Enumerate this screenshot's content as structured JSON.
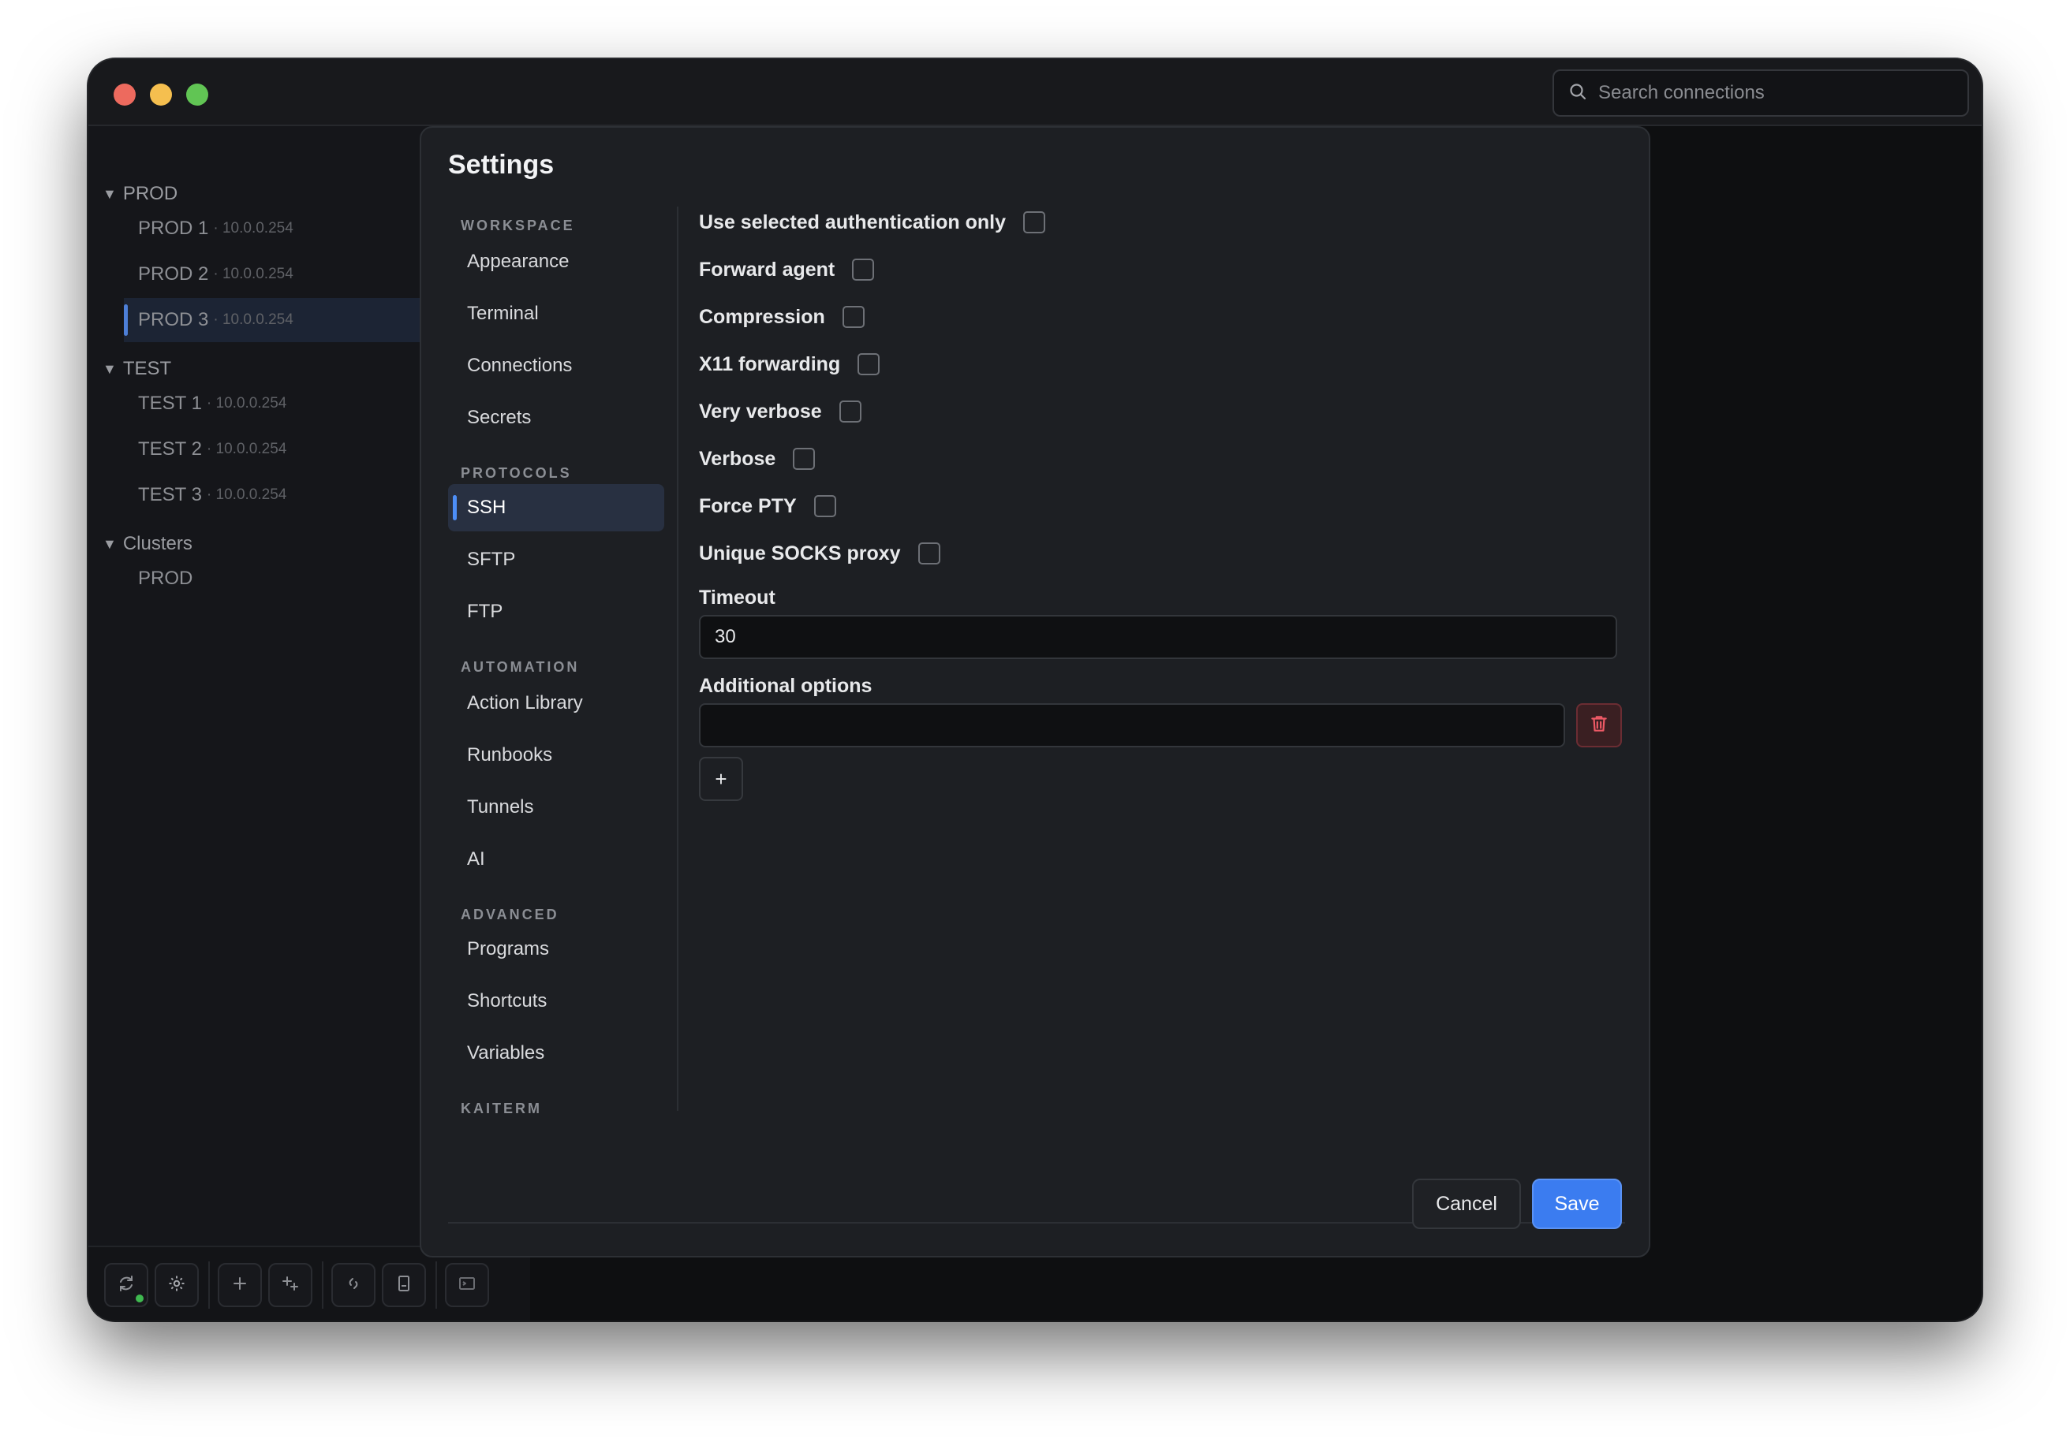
{
  "window": {
    "search_placeholder": "Search connections"
  },
  "sidebar": {
    "groups": [
      {
        "label": "PROD",
        "items": [
          {
            "name": "PROD 1",
            "ip": "· 10.0.0.254"
          },
          {
            "name": "PROD 2",
            "ip": "· 10.0.0.254"
          },
          {
            "name": "PROD 3",
            "ip": "· 10.0.0.254",
            "active": true
          }
        ]
      },
      {
        "label": "TEST",
        "items": [
          {
            "name": "TEST 1",
            "ip": "· 10.0.0.254"
          },
          {
            "name": "TEST 2",
            "ip": "· 10.0.0.254"
          },
          {
            "name": "TEST 3",
            "ip": "· 10.0.0.254"
          }
        ]
      },
      {
        "label": "Clusters",
        "items": [
          {
            "name": "PROD",
            "ip": ""
          }
        ]
      }
    ],
    "bottom_icons": [
      "sync-icon",
      "gear-icon",
      "plus-icon",
      "sparkle-plus-icon",
      "link-icon",
      "bookmark-icon",
      "terminal-icon"
    ]
  },
  "settings": {
    "title": "Settings",
    "nav": {
      "workspace_label": "WORKSPACE",
      "workspace": [
        "Appearance",
        "Terminal",
        "Connections",
        "Secrets"
      ],
      "protocols_label": "PROTOCOLS",
      "protocols": [
        "SSH",
        "SFTP",
        "FTP"
      ],
      "automation_label": "AUTOMATION",
      "automation": [
        "Action Library",
        "Runbooks",
        "Tunnels",
        "AI"
      ],
      "advanced_label": "ADVANCED",
      "advanced": [
        "Programs",
        "Shortcuts",
        "Variables"
      ],
      "kaiterm_label": "KAITERM",
      "active": "SSH"
    },
    "ssh": {
      "options": [
        {
          "label": "Use selected authentication only",
          "checked": false
        },
        {
          "label": "Forward agent",
          "checked": false
        },
        {
          "label": "Compression",
          "checked": false
        },
        {
          "label": "X11 forwarding",
          "checked": false
        },
        {
          "label": "Very verbose",
          "checked": false
        },
        {
          "label": "Verbose",
          "checked": false
        },
        {
          "label": "Force PTY",
          "checked": false
        },
        {
          "label": "Unique SOCKS proxy",
          "checked": false
        }
      ],
      "timeout_label": "Timeout",
      "timeout_value": "30",
      "additional_label": "Additional options",
      "additional_value": "",
      "add_label": "+"
    },
    "footer": {
      "cancel": "Cancel",
      "save": "Save"
    }
  },
  "colors": {
    "accent": "#3b7cf0",
    "danger": "#e5535f",
    "background": "#0e0f11",
    "modal": "#1d1f23"
  }
}
